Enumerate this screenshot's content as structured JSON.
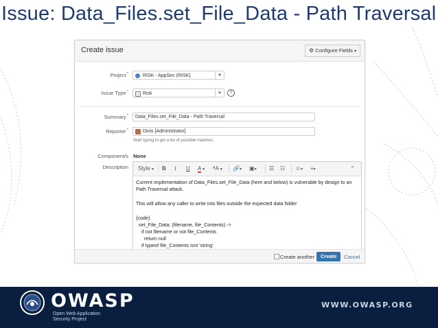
{
  "slide": {
    "title": "Issue: Data_Files.set_File_Data - Path Traversal"
  },
  "dialog": {
    "title": "Create issue",
    "configure_fields_label": "Configure Fields",
    "fields": {
      "project_label": "Project",
      "project_value": "RISK - AppSec (RISK)",
      "issue_type_label": "Issue Type",
      "issue_type_value": "Risk",
      "summary_label": "Summary",
      "summary_value": "Data_Files.set_File_Data - Path Traversal",
      "reporter_label": "Reporter",
      "reporter_value": "Dinis  [Administrator]",
      "reporter_hint": "Start typing to get a list of possible matches.",
      "components_label": "Component/s",
      "components_value": "None",
      "description_label": "Description",
      "required_marker": "*"
    },
    "editor": {
      "style_label": "Style",
      "bold": "B",
      "italic": "I",
      "underline": "U",
      "text_color": "A",
      "font_size": "ᴬA",
      "lines": [
        "Current implementation of Data_Files.set_File_Data (here and below) is vulnerable by design to an",
        "Path Traversal attack.",
        "",
        "This will allow any caller to write into files outside the expected data folder",
        "",
        "{code}",
        "  set_File_Data: (filename, file_Contents) ->",
        "    if not filename or not file_Contents",
        "      return null",
        "    if typeof file_Contents isnt 'string'"
      ]
    },
    "footer": {
      "create_another_label": "Create another",
      "create_label": "Create",
      "cancel_label": "Cancel"
    }
  },
  "banner": {
    "org_name": "OWASP",
    "tagline_line1": "Open Web Application",
    "tagline_line2": "Security Project",
    "url": "WWW.OWASP.ORG"
  },
  "colors": {
    "title": "#1e3a6e",
    "primary_button": "#3572b0",
    "banner_background": "#0a1f3f",
    "required": "#d04437"
  }
}
